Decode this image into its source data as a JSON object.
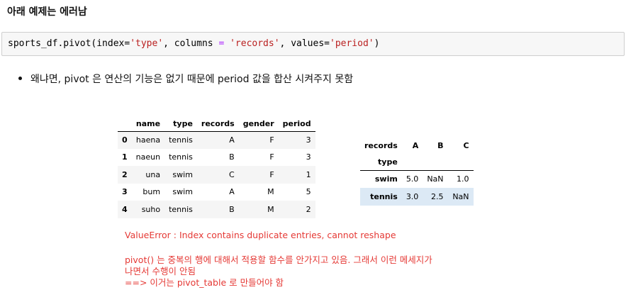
{
  "heading": "아래 예제는 에러남",
  "code": {
    "p1": "sports_df.pivot(index=",
    "s1": "'type'",
    "p2": ", columns ",
    "op1": "=",
    "p3": " ",
    "s2": "'records'",
    "p4": ", values=",
    "s3": "'period'",
    "p5": ")"
  },
  "bullet": "왜냐면, pivot 은 연산의 기능은 없기 때문에 period 값을 합산 시켜주지 못함",
  "table1": {
    "columns": [
      "name",
      "type",
      "records",
      "gender",
      "period"
    ],
    "rows": [
      {
        "index": "0",
        "cells": [
          "haena",
          "tennis",
          "A",
          "F",
          "3"
        ]
      },
      {
        "index": "1",
        "cells": [
          "naeun",
          "tennis",
          "B",
          "F",
          "3"
        ]
      },
      {
        "index": "2",
        "cells": [
          "una",
          "swim",
          "C",
          "F",
          "1"
        ]
      },
      {
        "index": "3",
        "cells": [
          "bum",
          "swim",
          "A",
          "M",
          "5"
        ]
      },
      {
        "index": "4",
        "cells": [
          "suho",
          "tennis",
          "B",
          "M",
          "2"
        ]
      }
    ]
  },
  "table2": {
    "columns_label": "records",
    "columns": [
      "A",
      "B",
      "C"
    ],
    "index_label": "type",
    "rows": [
      {
        "index": "swim",
        "cells": [
          "5.0",
          "NaN",
          "1.0"
        ]
      },
      {
        "index": "tennis",
        "cells": [
          "3.0",
          "2.5",
          "NaN"
        ]
      }
    ]
  },
  "notes": {
    "error": "ValueError : Index contains duplicate entries, cannot reshape",
    "line1": "pivot() 는 중복의 행에 대해서 적용할 함수를 안가지고 있음. 그래서 이런 메세지가",
    "line2": "나면서 수행이 안됨",
    "line3": "==> 이거는  pivot_table 로 만들어야 함"
  },
  "colors": {
    "note_text": "#e53935",
    "code_bg": "#f7f7f7",
    "table2_highlight": "#dce9f5"
  }
}
